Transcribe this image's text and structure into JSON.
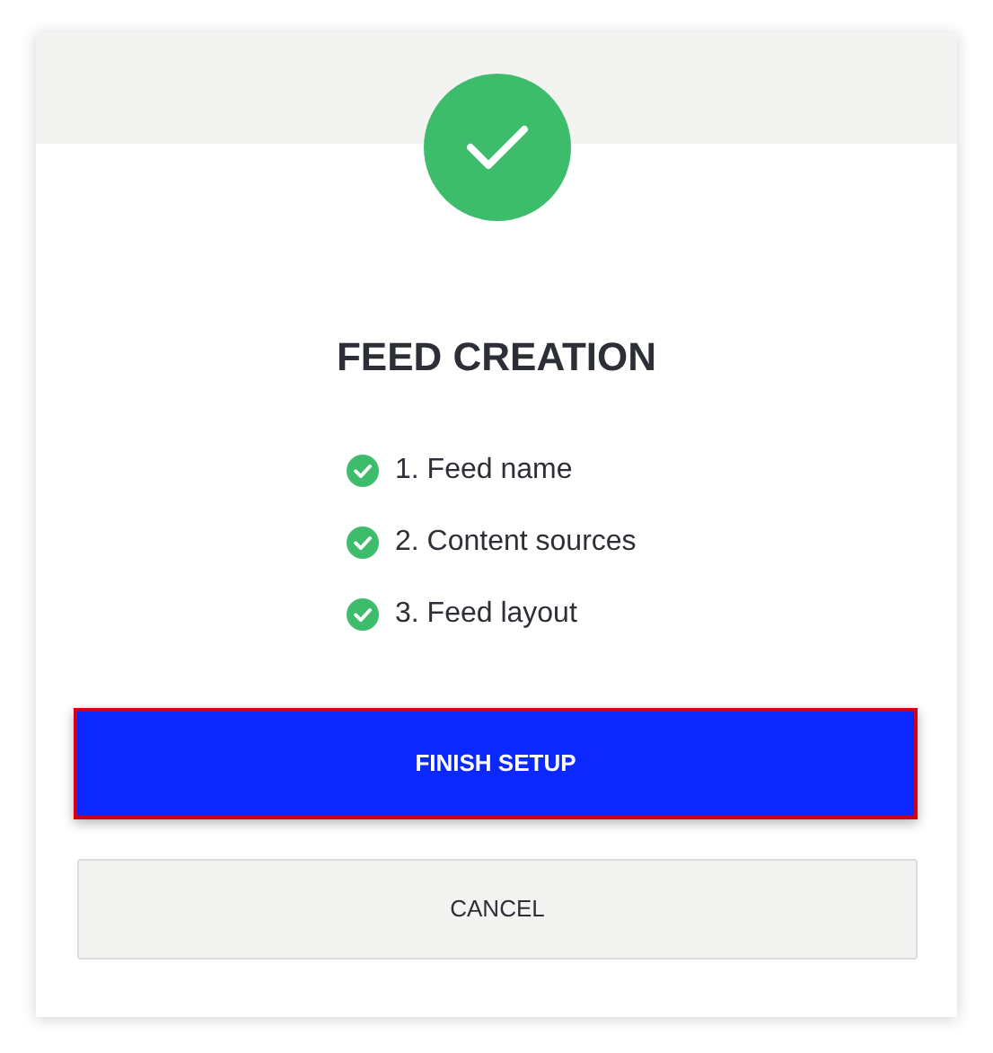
{
  "title": "FEED CREATION",
  "steps": [
    {
      "label": "1. Feed name",
      "done": true
    },
    {
      "label": "2. Content sources",
      "done": true
    },
    {
      "label": "3. Feed layout",
      "done": true
    }
  ],
  "buttons": [
    {
      "label": "FINISH SETUP",
      "kind": "primary",
      "focused": true
    },
    {
      "label": "CANCEL",
      "kind": "secondary",
      "focused": false
    }
  ]
}
